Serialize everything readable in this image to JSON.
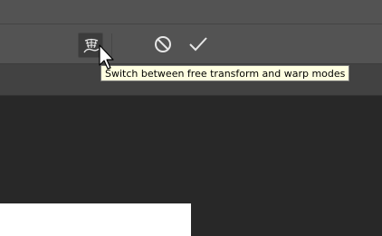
{
  "tooltip": {
    "text": "Switch between free transform and warp modes"
  },
  "icons": {
    "warp_toggle": "warp-mode-icon",
    "cancel": "cancel-transform-icon",
    "commit": "commit-transform-icon",
    "cursor": "mouse-pointer-icon"
  },
  "colors": {
    "options_bar": "#535353",
    "canvas_background": "#282828",
    "tooltip_background": "#ffffe1",
    "icon": "#e6e6e6"
  }
}
